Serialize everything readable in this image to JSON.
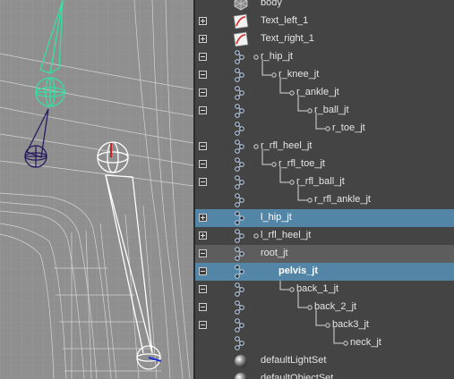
{
  "outliner": {
    "rows": [
      {
        "label": "body",
        "expander": "none",
        "icon": "mesh-icon",
        "state": ""
      },
      {
        "label": "Text_left_1",
        "expander": "plus",
        "icon": "curve-icon",
        "state": ""
      },
      {
        "label": "Text_right_1",
        "expander": "plus",
        "icon": "curve-icon",
        "state": ""
      },
      {
        "label": "r_hip_jt",
        "expander": "minus",
        "icon": "joint-icon",
        "state": ""
      },
      {
        "label": "r_knee_jt",
        "expander": "minus",
        "icon": "joint-icon",
        "state": ""
      },
      {
        "label": "r_ankle_jt",
        "expander": "minus",
        "icon": "joint-icon",
        "state": ""
      },
      {
        "label": "r_ball_jt",
        "expander": "minus",
        "icon": "joint-icon",
        "state": ""
      },
      {
        "label": "r_toe_jt",
        "expander": "none",
        "icon": "joint-icon",
        "state": ""
      },
      {
        "label": "r_rfl_heel_jt",
        "expander": "minus",
        "icon": "joint-icon",
        "state": ""
      },
      {
        "label": "r_rfl_toe_jt",
        "expander": "minus",
        "icon": "joint-icon",
        "state": ""
      },
      {
        "label": "r_rfl_ball_jt",
        "expander": "minus",
        "icon": "joint-icon",
        "state": ""
      },
      {
        "label": "r_rfl_ankle_jt",
        "expander": "none",
        "icon": "joint-icon",
        "state": ""
      },
      {
        "label": "l_hip_jt",
        "expander": "plus",
        "icon": "joint-icon",
        "state": "selected"
      },
      {
        "label": "l_rfl_heel_jt",
        "expander": "plus",
        "icon": "joint-icon",
        "state": ""
      },
      {
        "label": "root_jt",
        "expander": "minus",
        "icon": "joint-icon",
        "state": "hover"
      },
      {
        "label": "pelvis_jt",
        "expander": "minus",
        "icon": "joint-icon",
        "state": "selected"
      },
      {
        "label": "back_1_jt",
        "expander": "minus",
        "icon": "joint-icon",
        "state": ""
      },
      {
        "label": "back_2_jt",
        "expander": "minus",
        "icon": "joint-icon",
        "state": ""
      },
      {
        "label": "back3_jt",
        "expander": "minus",
        "icon": "joint-icon",
        "state": ""
      },
      {
        "label": "neck_jt",
        "expander": "none",
        "icon": "joint-icon",
        "state": ""
      },
      {
        "label": "defaultLightSet",
        "expander": "none",
        "icon": "set-icon",
        "state": ""
      },
      {
        "label": "defaultObjectSet",
        "expander": "none",
        "icon": "set-icon",
        "state": ""
      }
    ]
  },
  "colors": {
    "selected": "#5285a6",
    "hover": "#5d5d5d",
    "panel": "#444444",
    "viewport": "#8f8f8f",
    "wire": "#d8d8d8",
    "joint_green": "#35e0a0",
    "joint_blue": "#281a60",
    "joint_white": "#ffffff"
  }
}
